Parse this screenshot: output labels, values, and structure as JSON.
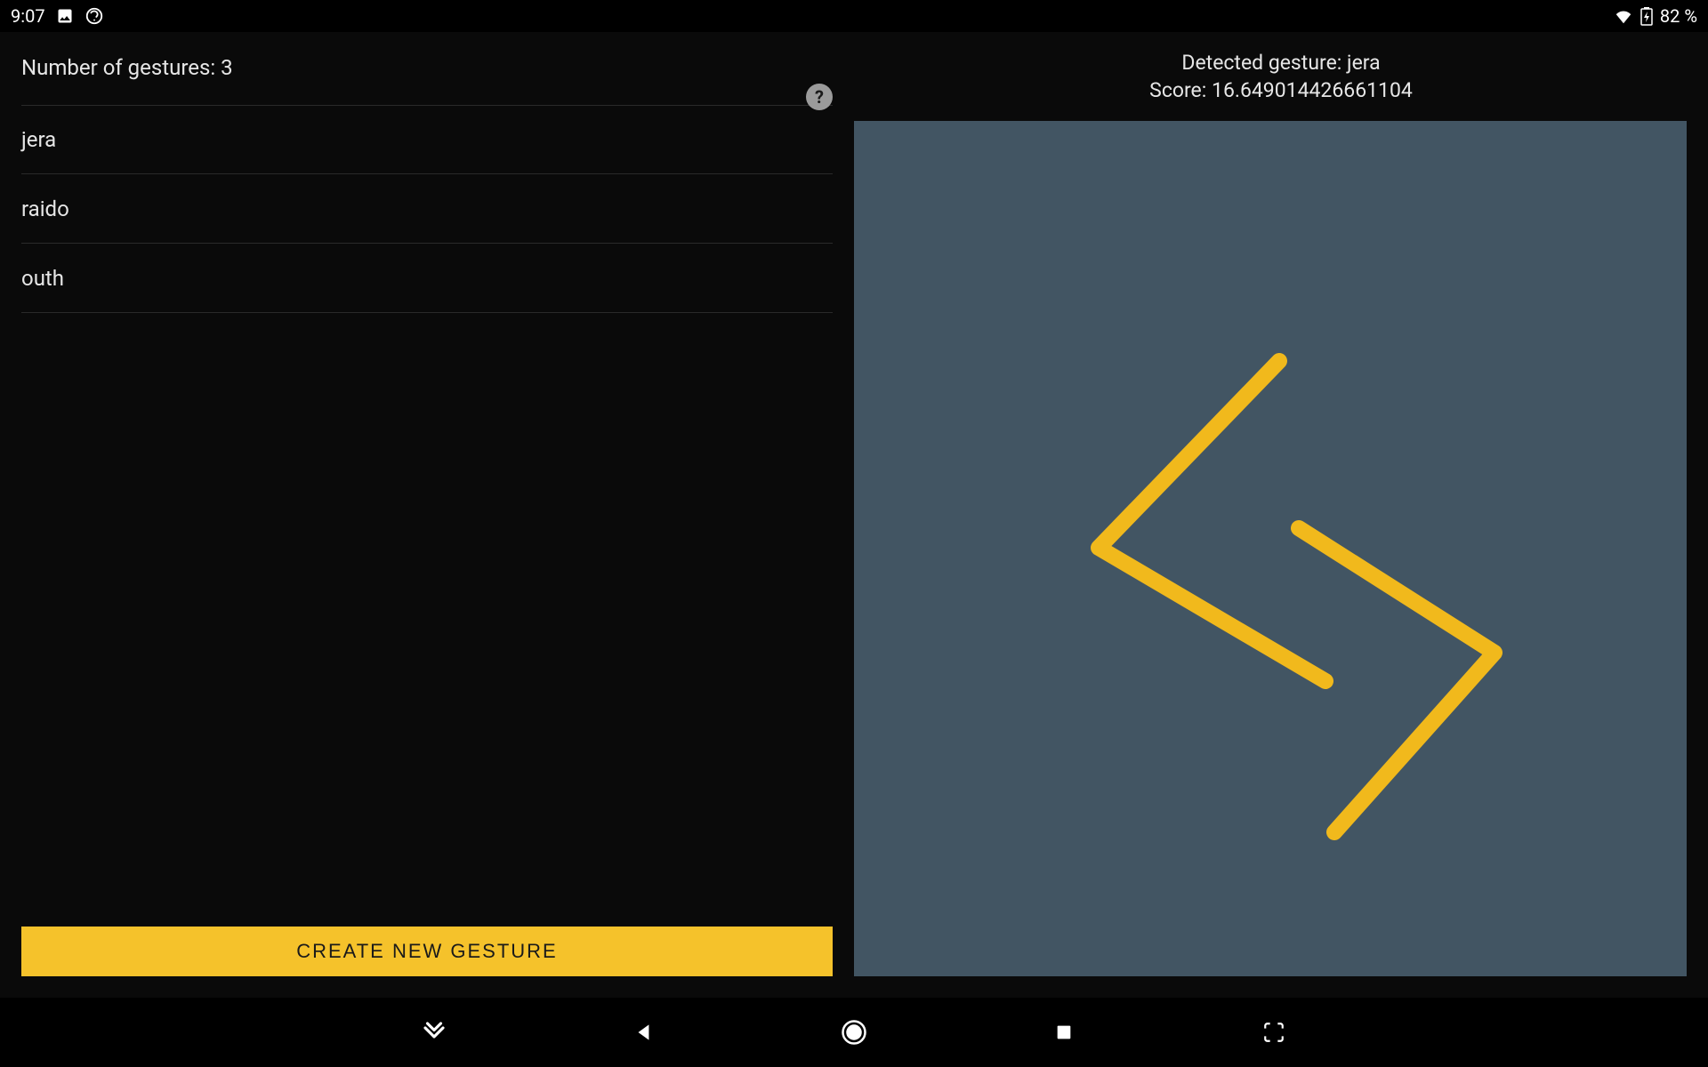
{
  "status": {
    "time": "9:07",
    "battery": "82 %"
  },
  "left_panel": {
    "count_label": "Number of gestures: 3",
    "gestures": [
      "jera",
      "raido",
      "outh"
    ],
    "create_button": "CREATE NEW GESTURE"
  },
  "right_panel": {
    "detected_line": "Detected gesture: jera",
    "score_line": "Score: 16.649014426661104"
  },
  "colors": {
    "accent": "#f5c22b",
    "canvas_bg": "#425563",
    "stroke": "#f1b91c"
  }
}
